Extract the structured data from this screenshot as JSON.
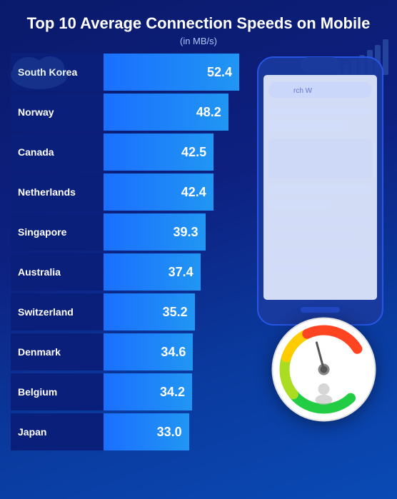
{
  "header": {
    "title": "Top 10 Average Connection Speeds on Mobile",
    "subtitle": "(in MB/s)"
  },
  "colors": {
    "background_dark": "#0a1a6b",
    "background_mid": "#0d2080",
    "bar_gradient_start": "#1a6fff",
    "bar_gradient_end": "#2196f3",
    "label_bg": "#0a1f7a",
    "text_white": "#ffffff",
    "text_light_blue": "#aec6ff"
  },
  "chart": {
    "rows": [
      {
        "country": "South Korea",
        "value": "52.4",
        "bar_class": "bar-south-korea"
      },
      {
        "country": "Norway",
        "value": "48.2",
        "bar_class": "bar-norway"
      },
      {
        "country": "Canada",
        "value": "42.5",
        "bar_class": "bar-canada"
      },
      {
        "country": "Netherlands",
        "value": "42.4",
        "bar_class": "bar-netherlands"
      },
      {
        "country": "Singapore",
        "value": "39.3",
        "bar_class": "bar-singapore"
      },
      {
        "country": "Australia",
        "value": "37.4",
        "bar_class": "bar-australia"
      },
      {
        "country": "Switzerland",
        "value": "35.2",
        "bar_class": "bar-switzerland"
      },
      {
        "country": "Denmark",
        "value": "34.6",
        "bar_class": "bar-denmark"
      },
      {
        "country": "Belgium",
        "value": "34.2",
        "bar_class": "bar-belgium"
      },
      {
        "country": "Japan",
        "value": "33.0",
        "bar_class": "bar-japan"
      }
    ]
  }
}
